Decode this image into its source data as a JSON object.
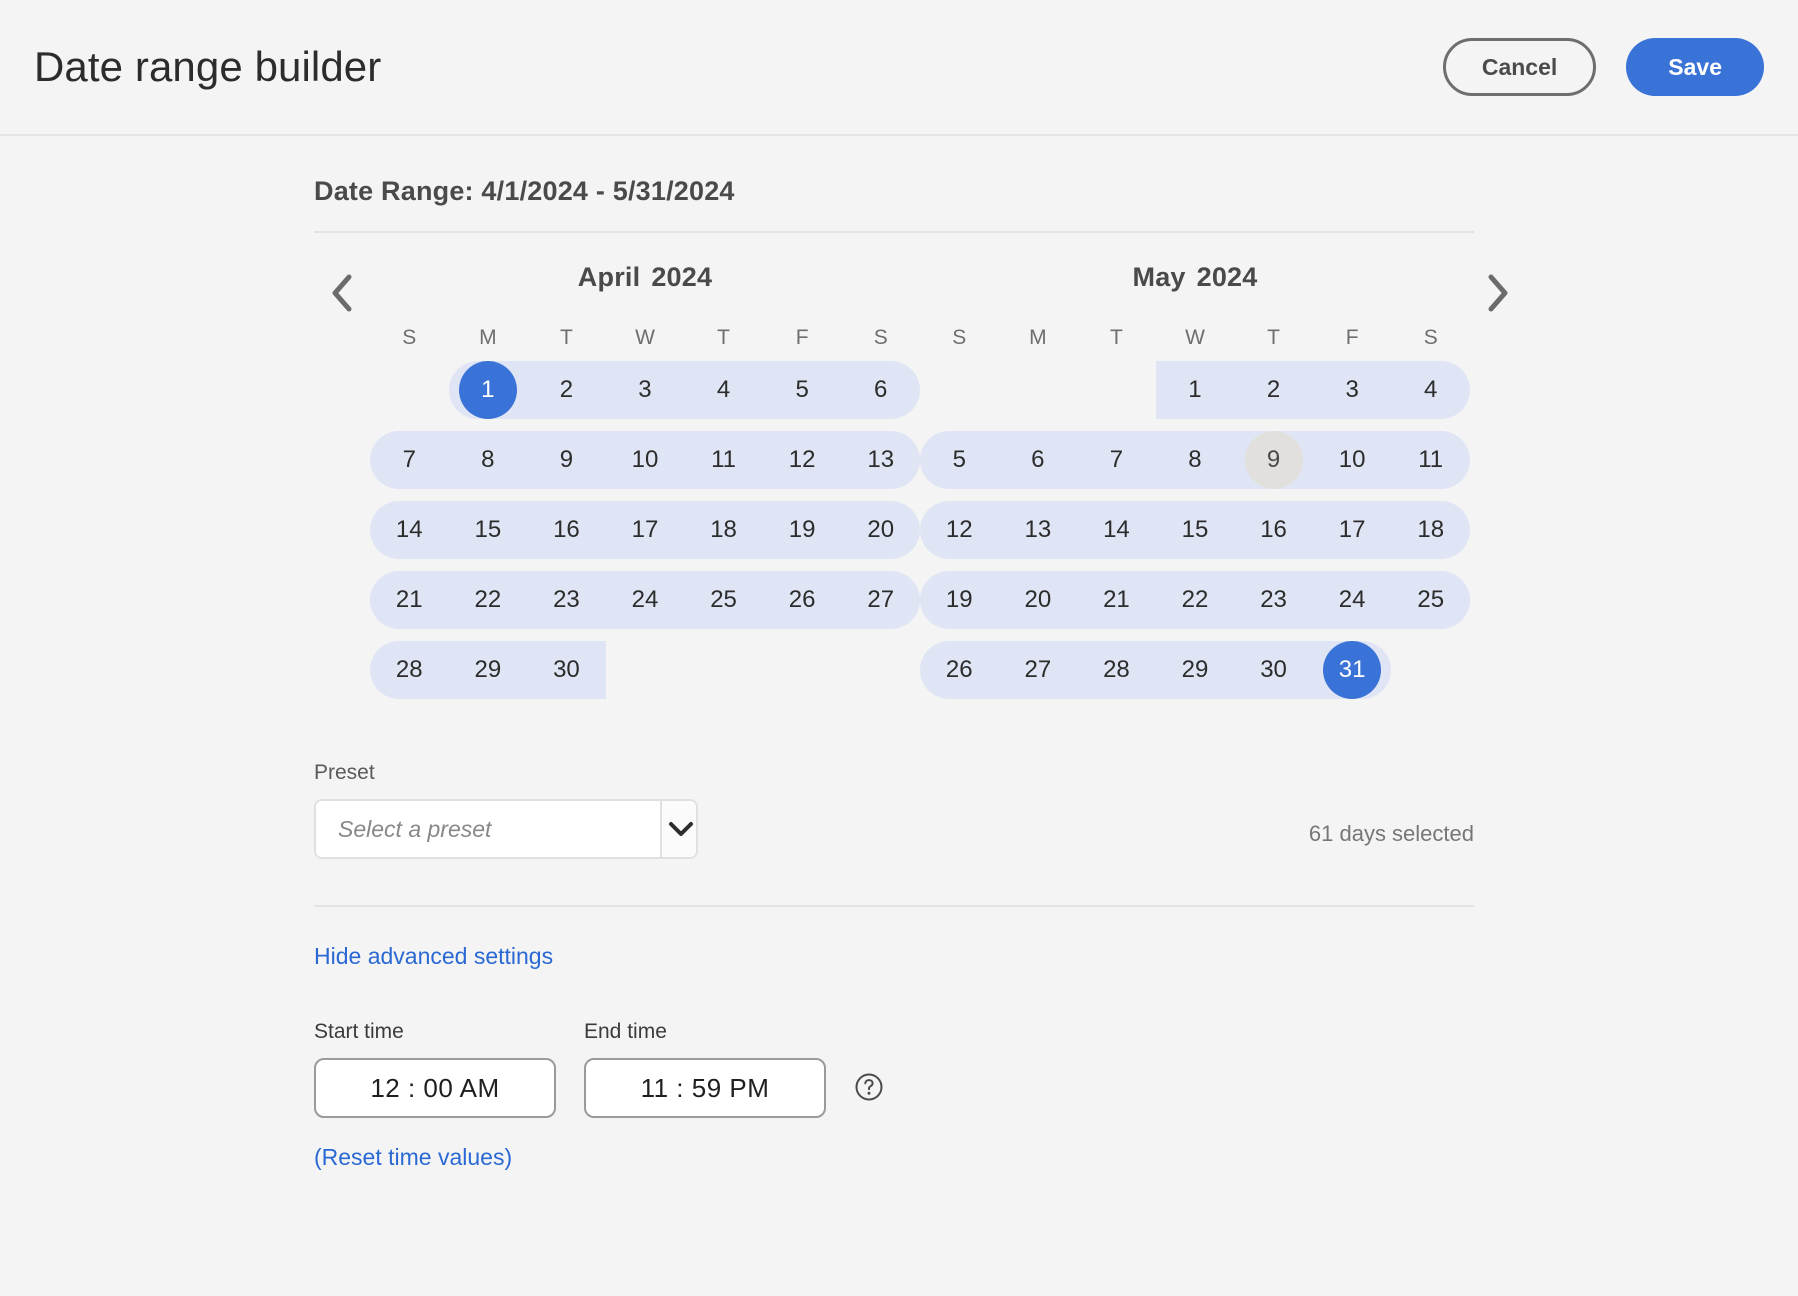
{
  "header": {
    "title": "Date range builder",
    "cancel_label": "Cancel",
    "save_label": "Save"
  },
  "range_title": "Date Range: 4/1/2024 - 5/31/2024",
  "calendars": {
    "prev_label": "Previous month",
    "next_label": "Next month",
    "dow": [
      "S",
      "M",
      "T",
      "W",
      "T",
      "F",
      "S"
    ],
    "left": {
      "month": "April",
      "year": "2024",
      "weeks": [
        [
          "",
          "1",
          "2",
          "3",
          "4",
          "5",
          "6"
        ],
        [
          "7",
          "8",
          "9",
          "10",
          "11",
          "12",
          "13"
        ],
        [
          "14",
          "15",
          "16",
          "17",
          "18",
          "19",
          "20"
        ],
        [
          "21",
          "22",
          "23",
          "24",
          "25",
          "26",
          "27"
        ],
        [
          "28",
          "29",
          "30",
          "",
          "",
          "",
          ""
        ]
      ]
    },
    "right": {
      "month": "May",
      "year": "2024",
      "weeks": [
        [
          "",
          "",
          "",
          "1",
          "2",
          "3",
          "4"
        ],
        [
          "5",
          "6",
          "7",
          "8",
          "9",
          "10",
          "11"
        ],
        [
          "12",
          "13",
          "14",
          "15",
          "16",
          "17",
          "18"
        ],
        [
          "19",
          "20",
          "21",
          "22",
          "23",
          "24",
          "25"
        ],
        [
          "26",
          "27",
          "28",
          "29",
          "30",
          "31",
          ""
        ]
      ]
    }
  },
  "preset": {
    "label": "Preset",
    "placeholder": "Select a preset",
    "value": "",
    "days_selected": "61 days selected"
  },
  "advanced": {
    "toggle_label": "Hide advanced settings",
    "start_time_label": "Start time",
    "start_time_value": "12 : 00  AM",
    "end_time_label": "End time",
    "end_time_value": "11 : 59  PM",
    "reset_label": "(Reset time values)"
  },
  "colors": {
    "accent": "#3a73d8",
    "link": "#2a69d4",
    "range_band": "#dfe5f4",
    "today": "#e2e0dd",
    "page_bg": "#f4f4f4"
  }
}
